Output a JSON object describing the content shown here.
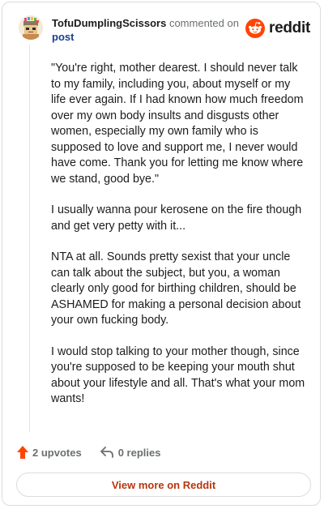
{
  "comment": {
    "author": "TofuDumplingScissors",
    "action_text": "commented on",
    "target": "post",
    "brand": "reddit",
    "brand_color": "#ff4500",
    "paragraphs": [
      "\"You're right, mother dearest. I should never talk to my family, including you, about myself or my life ever again. If I had known how much freedom over my own body insults and disgusts other women, especially my own family who is supposed to love and support me, I never would have come. Thank you for letting me know where we stand, good bye.\"",
      "I usually wanna pour kerosene on the fire though and get very petty with it...",
      "NTA at all. Sounds pretty sexist that your uncle can talk about the subject, but you, a woman clearly only good for birthing children, should be ASHAMED for making a personal decision about your own fucking body.",
      "I would stop talking to your mother though, since you're supposed to be keeping your mouth shut about your lifestyle and all. That's what your mom wants!"
    ]
  },
  "actions": {
    "upvotes": "2 upvotes",
    "replies": "0 replies",
    "upvote_icon": "upvote-arrow-icon",
    "reply_icon": "reply-arrow-icon",
    "upvote_color": "#ff4500"
  },
  "footer": {
    "view_more": "View more on Reddit",
    "view_more_color": "#b8350f"
  }
}
